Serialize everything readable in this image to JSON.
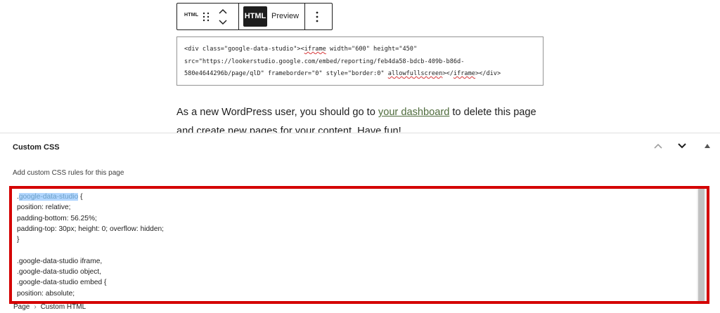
{
  "toolbar": {
    "block_icon_label": "HTML",
    "html_tab": "HTML",
    "preview_tab": "Preview"
  },
  "code_block": {
    "line1_a": "<div class=\"google-data-studio\"><",
    "line1_b": "iframe",
    "line1_c": " width=\"600\" height=\"450\"",
    "line2": "src=\"https://lookerstudio.google.com/embed/reporting/feb4da58-bdcb-409b-b86d-",
    "line3_a": "580e4644296b/page/qlD\" frameborder=\"0\" style=\"border:0\" ",
    "line3_b": "allowfullscreen",
    "line3_c": "></",
    "line3_d": "iframe",
    "line3_e": "></div>"
  },
  "paragraph": {
    "before": "As a new WordPress user, you should go to ",
    "link": "your dashboard",
    "after": " to delete this page and create new pages for your content. Have fun!"
  },
  "custom_css": {
    "title": "Custom CSS",
    "help": "Add custom CSS rules for this page",
    "selected": "google-data-studio",
    "code_first_dot": ".",
    "code_after_selected": " {\nposition: relative;\npadding-bottom: 56.25%;\npadding-top: 30px; height: 0; overflow: hidden;\n}\n\n.google-data-studio iframe,\n.google-data-studio object,\n.google-data-studio embed {\nposition: absolute;"
  },
  "breadcrumb": {
    "root": "Page",
    "current": "Custom HTML"
  },
  "colors": {
    "highlight_border": "#d40000",
    "link": "#4e6b3c",
    "selection": "#b3d7ff"
  }
}
